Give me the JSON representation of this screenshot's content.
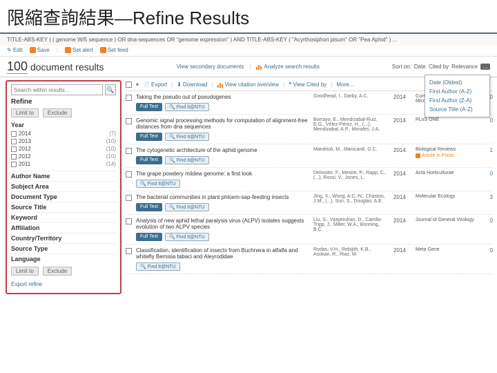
{
  "slide_title": "限縮查詢結果—Refine Results",
  "query": "TITLE-ABS-KEY ( ( genome  W/5  sequence )  OR  dna-sequences  OR  \"genome expression\" )  AND  TITLE-ABS-KEY ( \"Acyrthosiphon pisum\"  OR  \"Pea Aphid\" ) ...",
  "toolbar": {
    "edit": "Edit",
    "save": "Save",
    "setalert": "Set alert",
    "setfeed": "Set feed"
  },
  "results": {
    "count": "100",
    "label": "document results"
  },
  "viewtabs": {
    "secondary": "View secondary documents",
    "analyze": "Analyze search results"
  },
  "sort": {
    "label": "Sort on:",
    "options_inline": [
      "Date",
      "Cited by",
      "Relevance"
    ],
    "dropdown": [
      "Date (Oldest)",
      "First Author (A-Z)",
      "First Author (Z-A)",
      "Source Title (A-Z)"
    ]
  },
  "contentbar": {
    "export": "Export",
    "download": "Download",
    "viewcited": "View citation overview",
    "viewcitedby": "View Cited by",
    "more": "More..."
  },
  "refine": {
    "search_placeholder": "Search within results...",
    "heading": "Refine",
    "limit": "Limit to",
    "exclude": "Exclude",
    "year_title": "Year",
    "years": [
      {
        "label": "2014",
        "count": "(7)"
      },
      {
        "label": "2013",
        "count": "(10)"
      },
      {
        "label": "2012",
        "count": "(10)"
      },
      {
        "label": "2012",
        "count": "(10)"
      },
      {
        "label": "2011",
        "count": "(14)"
      }
    ],
    "facets": [
      "Author Name",
      "Subject Area",
      "Document Type",
      "Source Title",
      "Keyword",
      "Affiliation",
      "Country/Territory",
      "Source Type",
      "Language"
    ],
    "export": "Export refine"
  },
  "chips": {
    "fulltext": "Full Text",
    "findit": "Find It@NTU"
  },
  "items": [
    {
      "title": "Taking the pseudo out of pseudogenes",
      "authors": "Goodhead, I., Darby, A.C.",
      "year": "2014",
      "source": "Current Opinion in Microbiology",
      "cited": "0"
    },
    {
      "title": "Genomic signal processing methods for computation of alignment-free distances from dna sequences",
      "authors": "Borrayo, E., Mendizabal-Ruiz, E.G., Vélez-Pérez, H., (...), Mendizabal, A.P., Morales, J.A.",
      "year": "2014",
      "source": "PLoS ONE",
      "cited": "0"
    },
    {
      "title": "The cytogenetic architecture of the aphid genome",
      "authors": "Mandrioli, M., Manicardi, G.C.",
      "year": "2014",
      "source": "Biological Reviews",
      "cited": "1",
      "aip": "Article in Press"
    },
    {
      "title": "The grape powdery mildew genome: a first look",
      "authors": "Delmotte, F., Mestre, P., Rapp, C., (...), Rossi, V., Jones, L.",
      "year": "2014",
      "source": "Acta Horticulturae",
      "cited": "0",
      "fulltext": false
    },
    {
      "title": "The bacterial communities in plant phloem-sap-feeding insects",
      "authors": "Jing, X., Wong, A.C.-N., Chaston, J.M., (...), Sun, S., Douglas, A.E.",
      "year": "2014",
      "source": "Molecular Ecology",
      "cited": "3"
    },
    {
      "title": "Analysis of new aphid lethal paralysis virus (ALPV) isolates suggests evolution of two ALPV species",
      "authors": "Liu, S., Vijayendran, D., Carrillo-Tripp, J., Miller, W.A., Bonning, B.C.",
      "year": "2014",
      "source": "Journal of General Virology",
      "cited": "0"
    },
    {
      "title": "Classification, identification of insects from Buchnera in alfalfa and whitefly Bemisia tabaci and Aleyrodidae",
      "authors": "Rodas, V.H., Rebijith, K.B., Asokan, R., Riaz, M.",
      "year": "2014",
      "source": "Meta Gene",
      "cited": "0",
      "fulltext": false
    }
  ]
}
